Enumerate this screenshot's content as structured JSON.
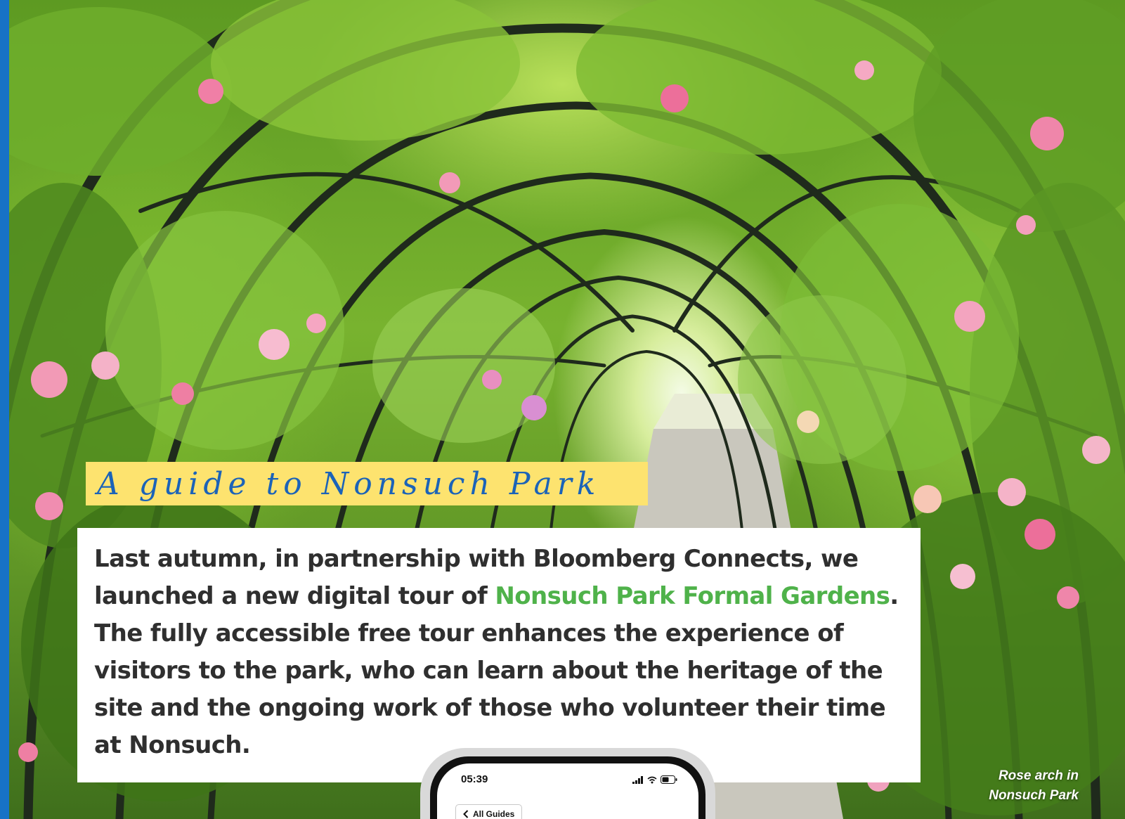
{
  "colors": {
    "stripe": "#1772c6",
    "title_banner": "#fde36f",
    "title_text": "#1b63b8",
    "body_text": "#2f2f2f",
    "link_green": "#4fb24a"
  },
  "title": "A guide to Nonsuch Park",
  "intro": {
    "part1": "Last autumn, in partnership with Bloomberg Connects, we launched a new digital tour of ",
    "link_text": "Nonsuch Park Formal Gardens",
    "part2": ". The fully accessible free tour enhances the experience of visitors to the park, who can learn about the heritage of the site and the ongoing work of those who volunteer their time at Nonsuch."
  },
  "phone": {
    "time": "05:39",
    "back_label": "All Guides",
    "icons": [
      "signal-icon",
      "wifi-icon",
      "battery-icon",
      "chevron-left-icon"
    ]
  },
  "caption": {
    "line1": "Rose arch in",
    "line2": "Nonsuch Park"
  }
}
